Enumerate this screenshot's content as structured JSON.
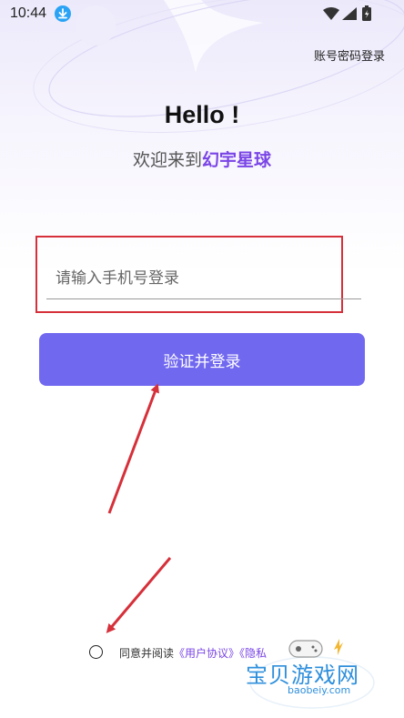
{
  "status_bar": {
    "time": "10:44",
    "icons": [
      "download-notification-icon",
      "wifi-icon",
      "signal-icon",
      "battery-icon"
    ]
  },
  "header": {
    "account_login_label": "账号密码登录"
  },
  "greeting": {
    "title": "Hello !",
    "welcome_prefix": "欢迎来到",
    "brand_name": "幻宇星球"
  },
  "login_form": {
    "phone_placeholder": "请输入手机号登录",
    "phone_value": "",
    "submit_label": "验证并登录"
  },
  "agreement": {
    "prefix": "同意并阅读",
    "user_agreement": "《用户协议》",
    "privacy_policy": "《隐私"
  },
  "watermark": {
    "site_name": "宝贝游戏网",
    "site_url": "baobeiy.com"
  },
  "colors": {
    "accent": "#7168f0",
    "brand_text": "#7a45e6",
    "annotation_red": "#d6303a",
    "watermark_blue": "#2e8fdc"
  }
}
